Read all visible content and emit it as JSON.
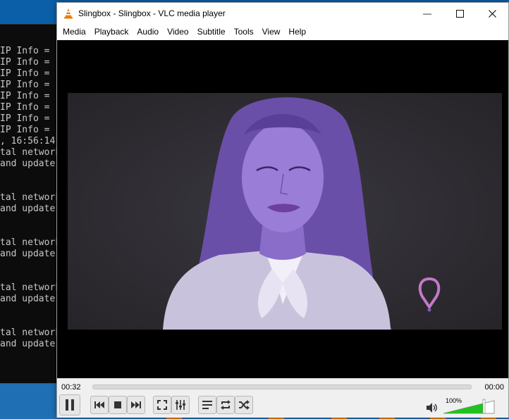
{
  "window": {
    "title": "Slingbox - Slingbox - VLC media player",
    "minimize_glyph": "—",
    "maximize_glyph": "☐",
    "close_glyph": "✕"
  },
  "menu": [
    "Media",
    "Playback",
    "Audio",
    "Video",
    "Subtitle",
    "Tools",
    "View",
    "Help"
  ],
  "console": {
    "lines": [
      "IP Info =",
      "IP Info =",
      "IP Info =",
      "IP Info =",
      "IP Info =",
      "IP Info =",
      "IP Info =",
      "IP Info =",
      ", 16:56:14.",
      "tal network",
      "and update",
      "",
      "",
      "tal network",
      "and update",
      "",
      "",
      "tal network",
      "and update",
      "",
      "",
      "tal network",
      "and update",
      "",
      "",
      "tal network",
      "and update"
    ]
  },
  "player": {
    "elapsed": "00:32",
    "remaining": "00:00",
    "progress": 0,
    "volume_label": "100%",
    "volume_level": 1.0
  },
  "colors": {
    "accent": "#e8800e",
    "volume_fill": "#21c21f",
    "video_tint": "#7a5cc4"
  },
  "icons": {
    "pause": "pause-icon",
    "prev": "previous-icon",
    "stop": "stop-icon",
    "next": "next-icon",
    "fullscreen": "fullscreen-icon",
    "extended": "extended-settings-icon",
    "playlist": "playlist-icon",
    "loop": "loop-icon",
    "random": "shuffle-icon",
    "volume": "speaker-icon"
  }
}
